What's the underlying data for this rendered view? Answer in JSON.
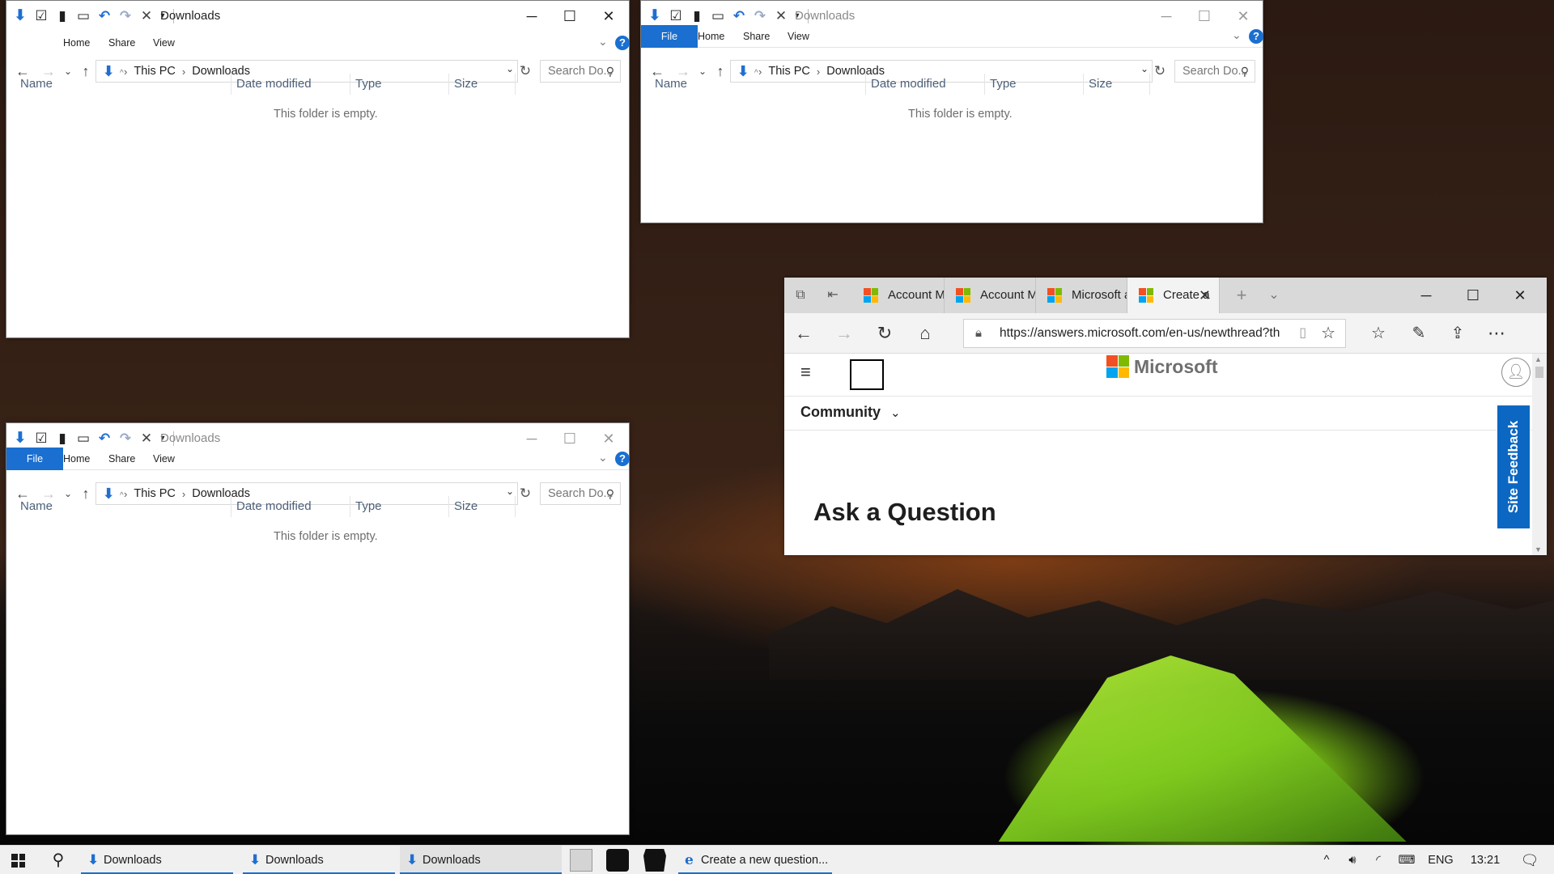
{
  "explorer": {
    "title": "Downloads",
    "tabs": {
      "file": "File",
      "home": "Home",
      "share": "Share",
      "view": "View"
    },
    "help": "?",
    "path": {
      "root": "This PC",
      "folder": "Downloads"
    },
    "search_placeholder": "Search Do...",
    "columns": {
      "name": "Name",
      "date": "Date modified",
      "type": "Type",
      "size": "Size"
    },
    "empty_message": "This folder is empty."
  },
  "browser": {
    "tabs": [
      {
        "label": "Account Mi"
      },
      {
        "label": "Account Mi"
      },
      {
        "label": "Microsoft a"
      },
      {
        "label": "Create a"
      }
    ],
    "url": "https://answers.microsoft.com/en-us/newthread?th",
    "brand": "Microsoft",
    "nav_label": "Community",
    "heading": "Ask a Question",
    "site_feedback": "Site Feedback",
    "logo_colors": [
      "#f25022",
      "#7fba00",
      "#00a4ef",
      "#ffb900"
    ]
  },
  "taskbar": {
    "items": [
      {
        "label": "Downloads"
      },
      {
        "label": "Downloads"
      },
      {
        "label": "Downloads"
      },
      {
        "label": "Create a new question..."
      }
    ],
    "language": "ENG",
    "time": "13:21"
  },
  "colors": {
    "accent": "#1a6fd0",
    "feedback": "#0b67c2"
  }
}
